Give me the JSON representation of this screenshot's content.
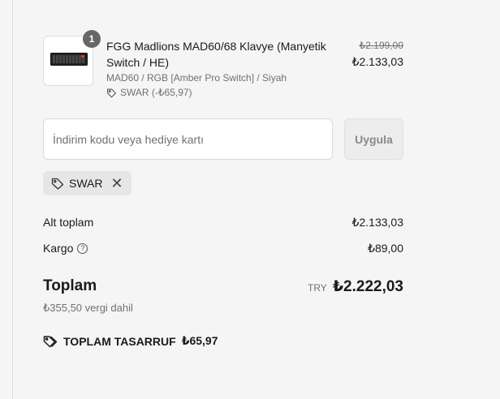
{
  "product": {
    "quantity_badge": "1",
    "name": "FGG Madlions MAD60/68 Klavye (Manyetik Switch / HE)",
    "variant": "MAD60 / RGB [Amber Pro Switch] / Siyah",
    "discount": "SWAR (-₺65,97)",
    "price_original": "₺2.199,00",
    "price_final": "₺2.133,03"
  },
  "discount_form": {
    "placeholder": "İndirim kodu veya hediye kartı",
    "value": "",
    "apply_label": "Uygula"
  },
  "applied_code": {
    "code": "SWAR",
    "remove_symbol": "✕"
  },
  "summary": {
    "subtotal_label": "Alt toplam",
    "subtotal_value": "₺2.133,03",
    "shipping_label": "Kargo",
    "shipping_help": "?",
    "shipping_value": "₺89,00",
    "total_label": "Toplam",
    "total_currency": "TRY",
    "total_value": "₺2.222,03",
    "tax_note": "₺355,50 vergi dahil",
    "savings_label": "TOPLAM TASARRUF",
    "savings_value": "₺65,97"
  },
  "colors": {
    "background": "#f5f5f5",
    "text": "#1a1a1a",
    "muted": "#707070",
    "badge": "#666666"
  },
  "icons": [
    "keyboard-product-image",
    "tag-icon",
    "close-icon",
    "help-circle-icon",
    "tags-icon"
  ]
}
